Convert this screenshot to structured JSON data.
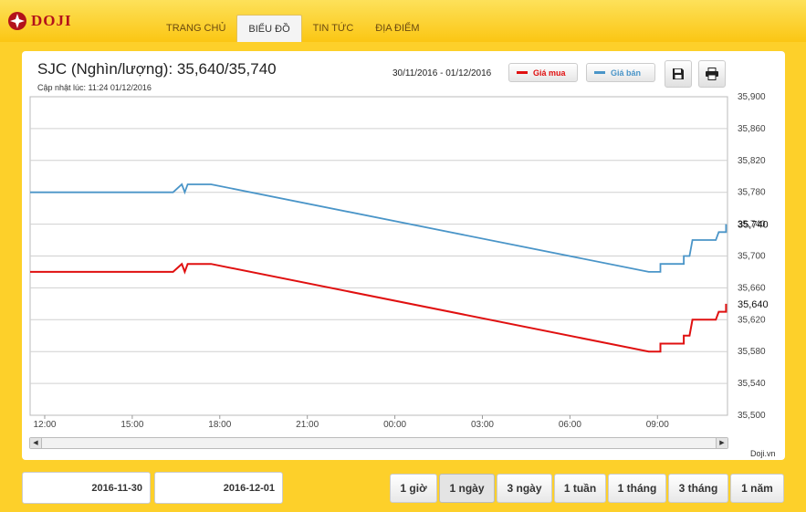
{
  "brand": {
    "logo_text": "DOJI",
    "credit": "Doji.vn"
  },
  "nav": {
    "items": [
      {
        "label": "TRANG CHỦ",
        "active": false
      },
      {
        "label": "BIỂU ĐỒ",
        "active": true
      },
      {
        "label": "TIN TỨC",
        "active": false
      },
      {
        "label": "ĐỊA ĐIỂM",
        "active": false
      }
    ]
  },
  "header": {
    "title": "SJC (Nghìn/lượng): 35,640/35,740",
    "updated": "Cập nhật lúc: 11:24 01/12/2016",
    "date_range": "30/11/2016 - 01/12/2016",
    "legend_buy": "Giá mua",
    "legend_sell": "Giá bán",
    "save_icon": "floppy-disk-icon",
    "print_icon": "printer-icon"
  },
  "footer": {
    "from_date": "2016-11-30",
    "to_date": "2016-12-01",
    "ranges": [
      {
        "label": "1 giờ",
        "active": false
      },
      {
        "label": "1 ngày",
        "active": true
      },
      {
        "label": "3 ngày",
        "active": false
      },
      {
        "label": "1 tuần",
        "active": false
      },
      {
        "label": "1 tháng",
        "active": false
      },
      {
        "label": "3 tháng",
        "active": false
      },
      {
        "label": "1 năm",
        "active": false
      }
    ]
  },
  "colors": {
    "accent": "#fbc613",
    "buy": "#e01010",
    "sell": "#4a95c8",
    "logo_red": "#b3121a"
  },
  "chart_data": {
    "type": "line",
    "x_ticks": [
      "12:00",
      "15:00",
      "18:00",
      "21:00",
      "00:00",
      "03:00",
      "06:00",
      "09:00"
    ],
    "x_tick_hours": [
      12,
      15,
      18,
      21,
      24,
      27,
      30,
      33
    ],
    "xlim_hours": [
      11.5,
      35.4
    ],
    "y_ticks": [
      "35,500",
      "35,540",
      "35,580",
      "35,620",
      "35,660",
      "35,700",
      "35,740",
      "35,780",
      "35,820",
      "35,860",
      "35,900"
    ],
    "ylim": [
      35500,
      35900
    ],
    "grid": true,
    "series": [
      {
        "name": "Giá mua",
        "color": "#e01010",
        "last_label": "35,640",
        "points": [
          [
            11.5,
            35680
          ],
          [
            16.4,
            35680
          ],
          [
            16.7,
            35690
          ],
          [
            16.8,
            35680
          ],
          [
            16.9,
            35690
          ],
          [
            17.7,
            35690
          ],
          [
            32.7,
            35580
          ],
          [
            33.1,
            35580
          ],
          [
            33.1,
            35590
          ],
          [
            33.9,
            35590
          ],
          [
            33.9,
            35600
          ],
          [
            34.1,
            35600
          ],
          [
            34.2,
            35620
          ],
          [
            35.0,
            35620
          ],
          [
            35.1,
            35630
          ],
          [
            35.35,
            35630
          ],
          [
            35.35,
            35640
          ]
        ]
      },
      {
        "name": "Giá bán",
        "color": "#4a95c8",
        "last_label": "35,740",
        "points": [
          [
            11.5,
            35780
          ],
          [
            16.4,
            35780
          ],
          [
            16.7,
            35790
          ],
          [
            16.8,
            35780
          ],
          [
            16.9,
            35790
          ],
          [
            17.7,
            35790
          ],
          [
            32.7,
            35680
          ],
          [
            33.1,
            35680
          ],
          [
            33.1,
            35690
          ],
          [
            33.9,
            35690
          ],
          [
            33.9,
            35700
          ],
          [
            34.1,
            35700
          ],
          [
            34.2,
            35720
          ],
          [
            35.0,
            35720
          ],
          [
            35.1,
            35730
          ],
          [
            35.35,
            35730
          ],
          [
            35.35,
            35740
          ]
        ]
      }
    ]
  }
}
